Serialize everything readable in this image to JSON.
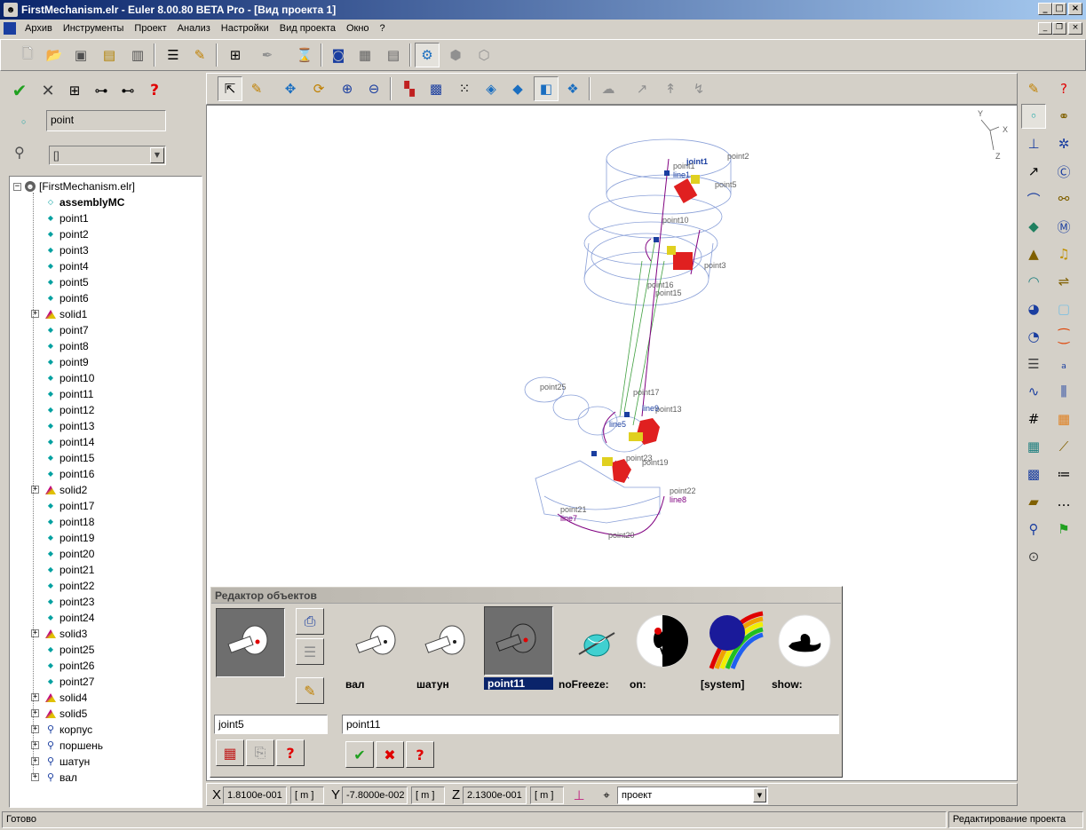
{
  "window": {
    "title": "FirstMechanism.elr - Euler 8.00.80 BETA Pro - [Вид проекта 1]",
    "minimize": "_",
    "maximize": "□",
    "close": "×"
  },
  "menu": {
    "items": [
      "Архив",
      "Инструменты",
      "Проект",
      "Анализ",
      "Настройки",
      "Вид проекта",
      "Окно",
      "?"
    ]
  },
  "left_panel": {
    "object_name": "point",
    "parent_value": "[]",
    "tree": {
      "root": "[FirstMechanism.elr]",
      "items": [
        {
          "label": "assemblyMC",
          "kind": "assembly",
          "bold": true
        },
        {
          "label": "point1",
          "kind": "point"
        },
        {
          "label": "point2",
          "kind": "point"
        },
        {
          "label": "point3",
          "kind": "point"
        },
        {
          "label": "point4",
          "kind": "point"
        },
        {
          "label": "point5",
          "kind": "point"
        },
        {
          "label": "point6",
          "kind": "point"
        },
        {
          "label": "solid1",
          "kind": "solid",
          "expandable": true
        },
        {
          "label": "point7",
          "kind": "point"
        },
        {
          "label": "point8",
          "kind": "point"
        },
        {
          "label": "point9",
          "kind": "point"
        },
        {
          "label": "point10",
          "kind": "point"
        },
        {
          "label": "point11",
          "kind": "point"
        },
        {
          "label": "point12",
          "kind": "point"
        },
        {
          "label": "point13",
          "kind": "point"
        },
        {
          "label": "point14",
          "kind": "point"
        },
        {
          "label": "point15",
          "kind": "point"
        },
        {
          "label": "point16",
          "kind": "point"
        },
        {
          "label": "solid2",
          "kind": "solid",
          "expandable": true
        },
        {
          "label": "point17",
          "kind": "point"
        },
        {
          "label": "point18",
          "kind": "point"
        },
        {
          "label": "point19",
          "kind": "point"
        },
        {
          "label": "point20",
          "kind": "point"
        },
        {
          "label": "point21",
          "kind": "point"
        },
        {
          "label": "point22",
          "kind": "point"
        },
        {
          "label": "point23",
          "kind": "point"
        },
        {
          "label": "point24",
          "kind": "point"
        },
        {
          "label": "solid3",
          "kind": "solid",
          "expandable": true
        },
        {
          "label": "point25",
          "kind": "point"
        },
        {
          "label": "point26",
          "kind": "point"
        },
        {
          "label": "point27",
          "kind": "point"
        },
        {
          "label": "solid4",
          "kind": "solid",
          "expandable": true
        },
        {
          "label": "solid5",
          "kind": "solid",
          "expandable": true
        },
        {
          "label": "корпус",
          "kind": "body",
          "expandable": true
        },
        {
          "label": "поршень",
          "kind": "body",
          "expandable": true
        },
        {
          "label": "шатун",
          "kind": "body",
          "expandable": true
        },
        {
          "label": "вал",
          "kind": "body",
          "expandable": true
        }
      ]
    }
  },
  "viewport": {
    "point_labels": [
      "point2",
      "joint1",
      "point1",
      "line1",
      "point5",
      "point10",
      "point3",
      "point16",
      "point15",
      "point25",
      "point17",
      "point13",
      "line9",
      "line5",
      "point19",
      "point23",
      "point22",
      "line8",
      "point21",
      "line7",
      "point20"
    ],
    "axes": {
      "x": "X",
      "y": "Y",
      "z": "Z"
    }
  },
  "object_editor": {
    "title": "Редактор объектов",
    "tiles": [
      {
        "label": "вал"
      },
      {
        "label": "шатун"
      },
      {
        "label": "point11",
        "selected": true
      },
      {
        "label": "noFreeze:"
      },
      {
        "label": "on:"
      },
      {
        "label": "[system]"
      },
      {
        "label": "show:"
      }
    ],
    "joint_name": "joint5",
    "value_field": "point11"
  },
  "coords": {
    "x_label": "X",
    "x_value": "1.8100e-001",
    "y_label": "Y",
    "y_value": "-7.8000e-002",
    "z_label": "Z",
    "z_value": "2.1300e-001",
    "unit": "[ m ]",
    "frame": "проект"
  },
  "status": {
    "left": "Готово",
    "right": "Редактирование проекта"
  },
  "colors": {
    "title_start": "#0a246a",
    "title_end": "#a6caf0",
    "face": "#d4d0c8",
    "point_cyan": "#00a0a0",
    "wire_blue": "#8aa0d8",
    "wire_purple": "#800080",
    "wire_green": "#40a040",
    "joint_red": "#e02020"
  }
}
